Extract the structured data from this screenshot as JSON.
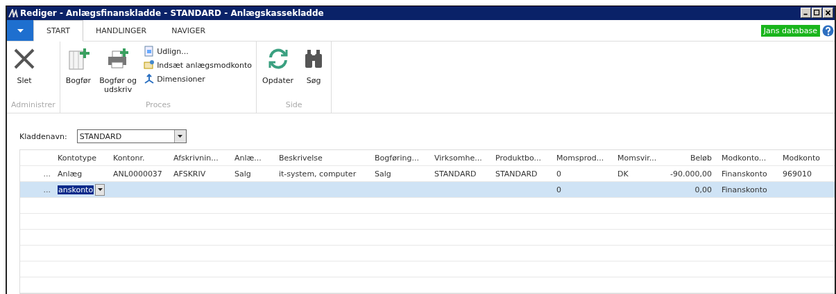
{
  "window": {
    "title": "Rediger - Anlægsfinanskladde - STANDARD - Anlægskassekladde"
  },
  "tabs": [
    {
      "label": "START",
      "selected": true
    },
    {
      "label": "HANDLINGER",
      "selected": false
    },
    {
      "label": "NAVIGER",
      "selected": false
    }
  ],
  "database_badge": "Jans database",
  "ribbon": [
    {
      "label": "Administrer",
      "items": [
        {
          "kind": "large",
          "label": "Slet"
        }
      ]
    },
    {
      "label": "Proces",
      "items": [
        {
          "kind": "large",
          "label": "Bogfør"
        },
        {
          "kind": "large",
          "label": "Bogfør og udskriv"
        },
        {
          "kind": "small",
          "label": "Udlign..."
        },
        {
          "kind": "small",
          "label": "Indsæt anlægsmodkonto"
        },
        {
          "kind": "small",
          "label": "Dimensioner"
        }
      ]
    },
    {
      "label": "Side",
      "items": [
        {
          "kind": "large",
          "label": "Opdater"
        },
        {
          "kind": "large",
          "label": "Søg"
        }
      ]
    }
  ],
  "journal": {
    "label": "Kladdenavn:",
    "value": "STANDARD"
  },
  "table": {
    "columns": [
      "Kontotype",
      "Kontonr.",
      "Afskrivnin...",
      "Anlæ...",
      "Beskrivelse",
      "Bogføring...",
      "Virksomhe...",
      "Produktbo...",
      "Momsprod...",
      "Momsvir...",
      "Beløb",
      "Modkonto...",
      "Modkonto"
    ],
    "rows": [
      {
        "selected": false,
        "menu": "...",
        "cells": [
          "Anlæg",
          "ANL0000037",
          "AFSKRIV",
          "Salg",
          "it-system, computer",
          "Salg",
          "STANDARD",
          "STANDARD",
          "0",
          "DK",
          "-90.000,00",
          "Finanskonto",
          "969010"
        ]
      },
      {
        "selected": true,
        "menu": "...",
        "editor": "anskonto",
        "cells": [
          null,
          null,
          null,
          null,
          null,
          null,
          null,
          null,
          "0",
          null,
          "0,00",
          "Finanskonto",
          null
        ]
      }
    ]
  }
}
